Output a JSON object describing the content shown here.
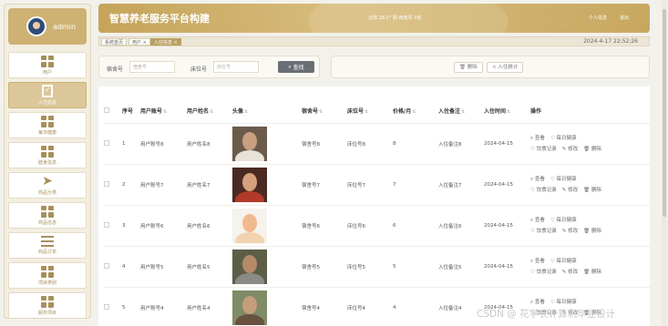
{
  "user": {
    "name": "admin"
  },
  "sidebar": {
    "items": [
      {
        "label": "用户",
        "icon": "grid-icon",
        "active": false
      },
      {
        "label": "入住信息",
        "icon": "clipboard-icon",
        "active": true
      },
      {
        "label": "每日健康",
        "icon": "grid-icon",
        "active": false
      },
      {
        "label": "膳食信息",
        "icon": "grid-icon",
        "active": false
      },
      {
        "label": "商品分类",
        "icon": "paper-plane-icon",
        "active": false
      },
      {
        "label": "商品信息",
        "icon": "grid-icon",
        "active": false
      },
      {
        "label": "商品订单",
        "icon": "list-icon",
        "active": false
      },
      {
        "label": "项目类别",
        "icon": "grid-icon",
        "active": false
      },
      {
        "label": "服务项目",
        "icon": "grid-icon",
        "active": false
      }
    ]
  },
  "header": {
    "title": "智慧养老服务平台构建",
    "weather": "云阵 28.2° 阴 西南风 1级",
    "profile_link": "个人信息",
    "logout_link": "退出"
  },
  "breadcrumb": {
    "home": "系统首页",
    "user": "用户 ×",
    "current": "入住信息 ×",
    "datetime": "2024-4-17 22:52:26"
  },
  "search": {
    "room_label": "宿舍号",
    "room_placeholder": "宿舍号",
    "bed_label": "床位号",
    "bed_placeholder": "床位号",
    "search_button": "查找"
  },
  "actions": {
    "delete": "删除",
    "stats": "入住统计"
  },
  "table": {
    "headers": [
      "序号",
      "用户账号",
      "用户姓名",
      "头像",
      "宿舍号",
      "床位号",
      "价格/月",
      "入住备注",
      "入住时间",
      "操作"
    ],
    "row_ops": {
      "view": "查看",
      "health": "每日健康",
      "diet": "饮食记录",
      "edit": "修改",
      "delete": "删除"
    },
    "rows": [
      {
        "seq": "1",
        "account": "用户账号8",
        "name": "用户姓名8",
        "room": "宿舍号8",
        "bed": "床位号8",
        "price": "8",
        "note": "入住备注8",
        "time": "2024-04-15"
      },
      {
        "seq": "2",
        "account": "用户账号7",
        "name": "用户姓名7",
        "room": "宿舍号7",
        "bed": "床位号7",
        "price": "7",
        "note": "入住备注7",
        "time": "2024-04-15"
      },
      {
        "seq": "3",
        "account": "用户账号6",
        "name": "用户姓名6",
        "room": "宿舍号6",
        "bed": "床位号6",
        "price": "6",
        "note": "入住备注6",
        "time": "2024-04-15"
      },
      {
        "seq": "4",
        "account": "用户账号5",
        "name": "用户姓名5",
        "room": "宿舍号5",
        "bed": "床位号5",
        "price": "5",
        "note": "入住备注5",
        "time": "2024-04-15"
      },
      {
        "seq": "5",
        "account": "用户账号4",
        "name": "用户姓名4",
        "room": "宿舍号4",
        "bed": "床位号4",
        "price": "4",
        "note": "入住备注4",
        "time": "2024-04-15"
      }
    ]
  },
  "watermark": "CSDN @ 花学长计算机毕业设计",
  "colors": {
    "accent": "#c5a45a",
    "active_menu": "#dcc79a",
    "sidebar_bg": "#f3eee2",
    "search_button": "#6a6f76"
  }
}
